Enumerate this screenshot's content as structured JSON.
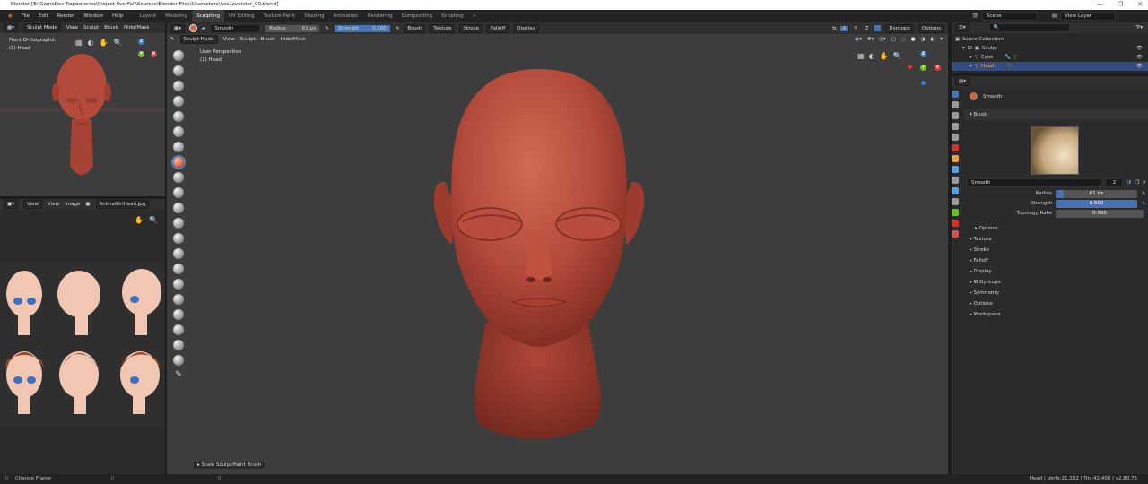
{
  "window": {
    "title": "Blender [E:\\GameDev Repositories\\Project EverFall\\Sources\\Blender Files\\Characters\\AxeLavender_00.blend]",
    "controls": [
      "—",
      "❐",
      "✕"
    ]
  },
  "menubar": {
    "items": [
      "File",
      "Edit",
      "Render",
      "Window",
      "Help"
    ]
  },
  "workspace_tabs": [
    "Layout",
    "Modeling",
    "Sculpting",
    "UV Editing",
    "Texture Paint",
    "Shading",
    "Animation",
    "Rendering",
    "Compositing",
    "Scripting",
    "+"
  ],
  "active_tab": "Sculpting",
  "scene": {
    "name": "Scene",
    "view_layer": "View Layer"
  },
  "left_viewport": {
    "header": [
      "Sculpt Mode",
      "View",
      "Sculpt",
      "Brush",
      "Hide/Mask"
    ],
    "view_name": "Front Orthographic",
    "object_name": "(1) Head"
  },
  "image_editor": {
    "header": [
      "View",
      "View",
      "Image"
    ],
    "image_name": "AnimeGirlHead.jpg"
  },
  "tool_header": {
    "brush_name": "Smooth",
    "radius_label": "Radius",
    "radius_value": "61 px",
    "strength_label": "Strength",
    "strength_value": "0.500",
    "menus": [
      "Brush",
      "Texture",
      "Stroke",
      "Falloff",
      "Display"
    ],
    "dyntopo": "Dyntopo",
    "options": "Options",
    "xyz": [
      "X",
      "Y",
      "Z"
    ]
  },
  "main_viewport": {
    "header": [
      "Sculpt Mode",
      "View",
      "Sculpt",
      "Brush",
      "Hide/Mask"
    ],
    "view_name": "User Perspective",
    "object_name": "(1) Head",
    "operator_panel": "Scale Sculpt/Paint Brush"
  },
  "outliner": {
    "title": "Scene Collection",
    "items": [
      {
        "name": "Sculpt",
        "level": 0
      },
      {
        "name": "Eyes",
        "level": 1
      },
      {
        "name": "Head",
        "level": 1,
        "selected": true
      }
    ]
  },
  "properties": {
    "active_brush": "Smooth",
    "brush_section": "Brush",
    "brush_datablock": "Smooth",
    "brush_users": "2",
    "fields": [
      {
        "label": "Radius",
        "value": "61 px",
        "fill": 0.0
      },
      {
        "label": "Strength",
        "value": "0.500",
        "fill": 1.0
      },
      {
        "label": "Topology Rake",
        "value": "0.000",
        "fill": 0.0
      }
    ],
    "options_sub": "Options",
    "sections": [
      "Texture",
      "Stroke",
      "Falloff",
      "Display",
      "Dyntopo",
      "Symmetry",
      "Options",
      "Workspace"
    ]
  },
  "statusbar": {
    "left": "Change Frame",
    "right": "Head | Verts:21,202 | Tris:42,400 | v2.80.75"
  },
  "colors": {
    "accent": "#4772b3",
    "clay": "#b34a3a",
    "viewport_bg": "#3d3d3d",
    "panel_bg": "#303030"
  }
}
